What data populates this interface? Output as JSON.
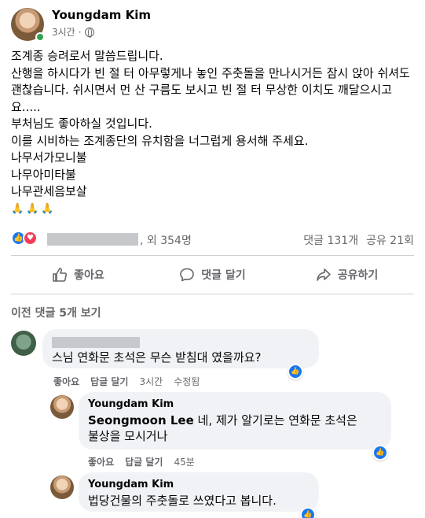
{
  "post": {
    "author": "Youngdam Kim",
    "time": "3시간",
    "more_icon": "…",
    "lines": [
      "조계종 승려로서 말씀드립니다.",
      "산행을 하시다가 빈 절 터 아무렇게나 놓인 주춧돌을 만나시거든 잠시 앉아 쉬셔도 괜찮습니다. 쉬시면서 먼 산 구름도 보시고 빈 절 터 무상한 이치도 깨달으시고요.....",
      "부처님도 좋아하실 것입니다.",
      "이를 시비하는 조계종단의 유치함을 너그럽게 용서해 주세요.",
      "나무서가모니불",
      "나무아미타불",
      "나무관세음보살"
    ],
    "emoji": "🙏🙏🙏"
  },
  "reactions": {
    "like_icon": "👍",
    "love_icon": "♥",
    "count": ", 외 354명",
    "comments": "댓글 131개",
    "shares": "공유 21회"
  },
  "actions": {
    "like": "좋아요",
    "comment": "댓글 달기",
    "share": "공유하기"
  },
  "comments_section": {
    "prev_label": "이전 댓글 5개 보기",
    "comments": [
      {
        "text": "스님 연화문 초석은 무슨 받침대 였을까요?",
        "like": "좋아요",
        "reply": "답글 달기",
        "time": "3시간",
        "edited": "수정됨"
      },
      {
        "name": "Youngdam Kim",
        "tag": "Seongmoon Lee",
        "text_line1": " 네, 제가 알기로는 연화문 초석은",
        "text_line2": "불상을 모시거나",
        "like": "좋아요",
        "reply": "답글 달기",
        "time": "45분"
      },
      {
        "name": "Youngdam Kim",
        "text": "법당건물의 주춧돌로 쓰였다고 봅니다."
      }
    ]
  },
  "colors": {
    "like_blue": "#1877f2",
    "love_red": "#f33e58",
    "online_green": "#31a24c",
    "secondary_text": "#65676b",
    "bubble_bg": "#f0f2f5"
  }
}
